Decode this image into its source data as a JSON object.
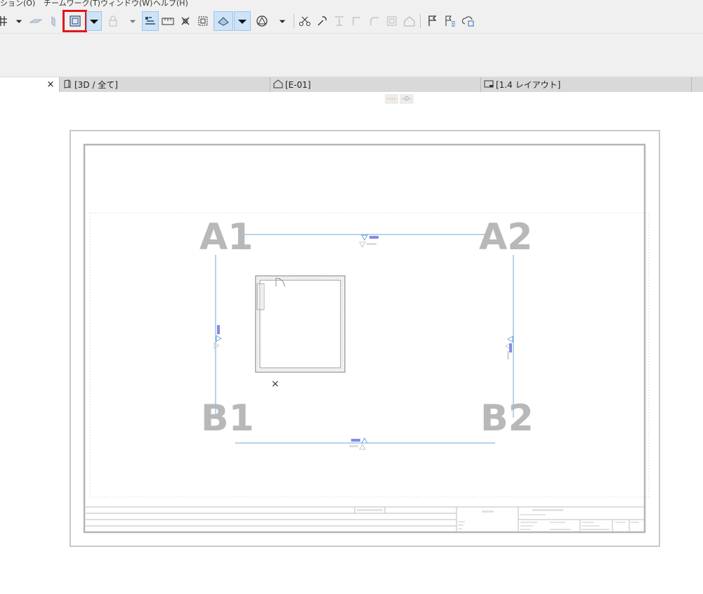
{
  "menu": [
    {
      "label": "ション(O)"
    },
    {
      "label": "チームワーク(T)"
    },
    {
      "label": "ウィンドウ(W)"
    },
    {
      "label": "ヘルプ(H)"
    }
  ],
  "tabs": {
    "close_glyph": "×",
    "items": [
      {
        "label": "[3D / 全て]",
        "icon": "3d-view-icon"
      },
      {
        "label": "[E-01]",
        "icon": "elevation-icon"
      },
      {
        "label": "[1.4 レイアウト]",
        "icon": "layout-icon"
      }
    ]
  },
  "view_controls": {
    "line_toggle": "----",
    "visibility_toggle": "-⊙-"
  },
  "drawing": {
    "grid_labels": {
      "a1": "A1",
      "a2": "A2",
      "b1": "B1",
      "b2": "B2"
    },
    "marker_glyph": "×"
  },
  "colors": {
    "highlight": "#e0161b",
    "active_tool": "#cde3f7",
    "grid_line": "#6ea9dc",
    "grid_label": "#b8b8b8",
    "marker": "#8888e8"
  }
}
